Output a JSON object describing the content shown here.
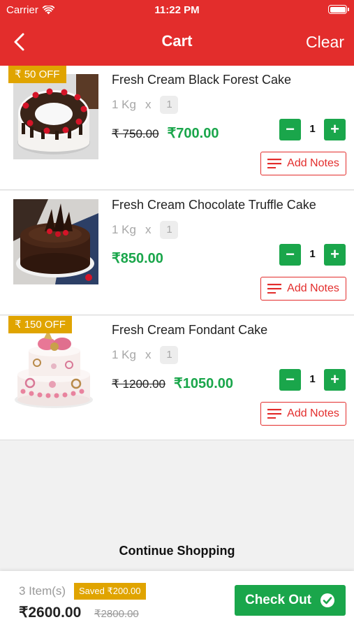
{
  "status_bar": {
    "carrier": "Carrier",
    "time": "11:22 PM"
  },
  "header": {
    "title": "Cart",
    "clear_label": "Clear"
  },
  "items": [
    {
      "offer": "₹ 50 OFF",
      "name": "Fresh Cream Black Forest Cake",
      "weight": "1 Kg",
      "x": "x",
      "count": "1",
      "old_price": "₹ 750.00",
      "price": "₹700.00",
      "qty": "1",
      "notes_label": "Add Notes",
      "image": "black-forest-cake-image"
    },
    {
      "offer": "",
      "name": "Fresh Cream Chocolate Truffle Cake",
      "weight": "1 Kg",
      "x": "x",
      "count": "1",
      "old_price": "",
      "price": "₹850.00",
      "qty": "1",
      "notes_label": "Add Notes",
      "image": "chocolate-truffle-cake-image"
    },
    {
      "offer": "₹ 150 OFF",
      "name": "Fresh Cream Fondant Cake",
      "weight": "1 Kg",
      "x": "x",
      "count": "1",
      "old_price": "₹ 1200.00",
      "price": "₹1050.00",
      "qty": "1",
      "notes_label": "Add Notes",
      "image": "fondant-cake-image"
    }
  ],
  "continue_label": "Continue Shopping",
  "footer": {
    "items_count": "3 Item(s)",
    "saved": "Saved ₹200.00",
    "total": "₹2600.00",
    "mrp": "₹2800.00",
    "checkout_label": "Check Out"
  },
  "colors": {
    "brand_red": "#e32d2c",
    "green": "#1aa64b",
    "offer_gold": "#e0a400"
  },
  "icons": [
    "wifi-icon",
    "battery-icon",
    "back-arrow-icon",
    "minus-icon",
    "plus-icon",
    "notes-icon",
    "check-circle-icon"
  ]
}
